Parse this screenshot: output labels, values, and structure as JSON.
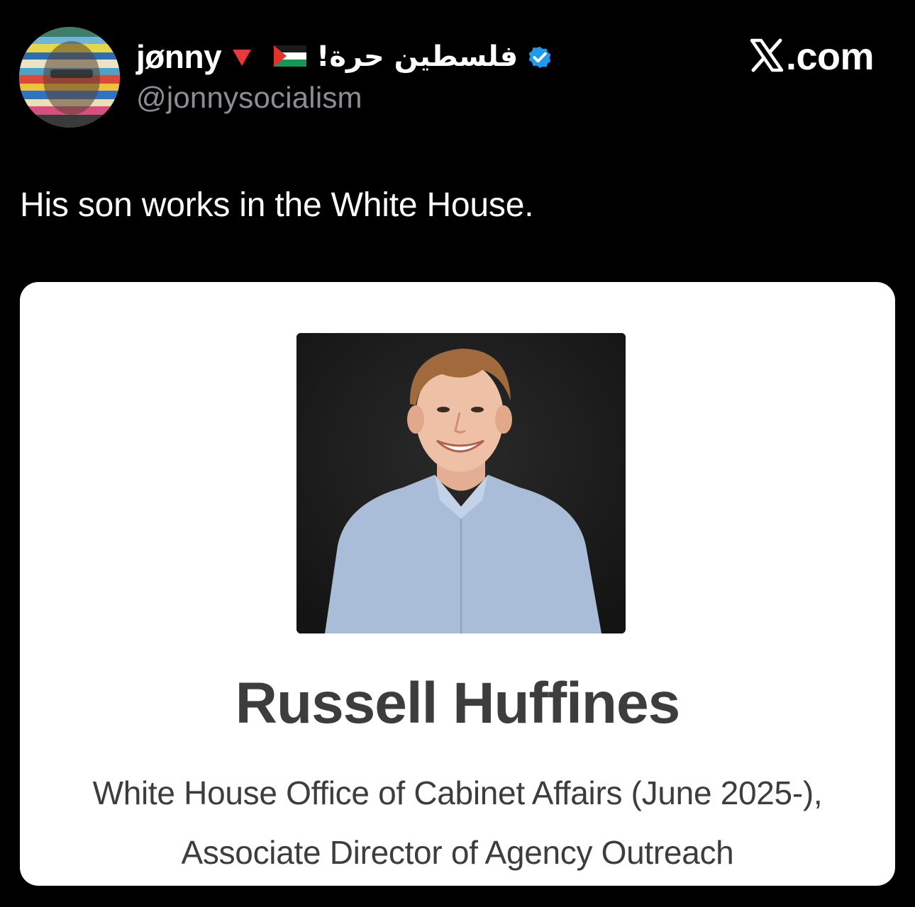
{
  "post": {
    "author": {
      "display_name": "jønny",
      "name_suffix_arabic": "فلسطين حرة!",
      "handle": "@jonnysocialism",
      "badge_icon": "verified-badge-icon",
      "badge_color": "#1d9bf0",
      "emoji_icons": [
        "red-triangle-icon",
        "palestine-flag-icon"
      ]
    },
    "source": {
      "domain": ".com",
      "logo_icon": "x-logo-icon"
    },
    "text": "His son works in the White House."
  },
  "card": {
    "name": "Russell Huffines",
    "role_line_1": "White House Office of Cabinet Affairs (June 2025-),",
    "role_line_2": "Associate Director of Agency Outreach"
  },
  "colors": {
    "background": "#000000",
    "handle_gray": "#8b8f94",
    "card_background": "#ffffff",
    "card_text": "#3d3d3d",
    "verified_blue": "#1d9bf0"
  }
}
